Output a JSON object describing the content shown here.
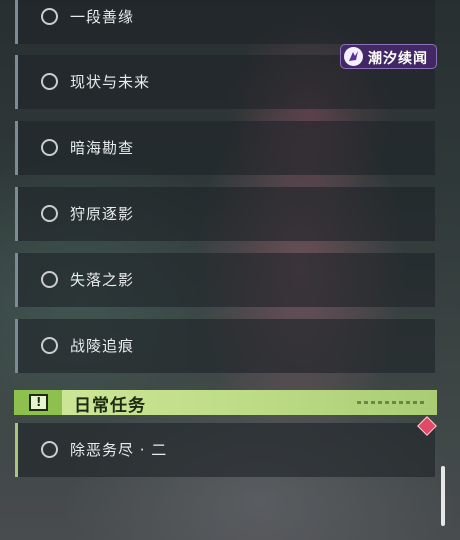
{
  "quests": [
    {
      "label": "一段善缘"
    },
    {
      "label": "现状与未来"
    },
    {
      "label": "暗海勘查"
    },
    {
      "label": "狩原逐影"
    },
    {
      "label": "失落之影"
    },
    {
      "label": "战陵追痕"
    }
  ],
  "daily_section": {
    "title": "日常任务",
    "badge_glyph": "!",
    "quests": [
      {
        "label": "除恶务尽 · 二"
      }
    ]
  },
  "watermark": {
    "text": "潮汐续闻"
  },
  "colors": {
    "accent": "#bedc86",
    "card": "#1e2428",
    "marker": "#e04a66",
    "watermark": "#46286e"
  },
  "icons": {
    "quest_status": "circle-icon",
    "section": "alert-box-icon",
    "marker": "diamond-marker-icon"
  }
}
